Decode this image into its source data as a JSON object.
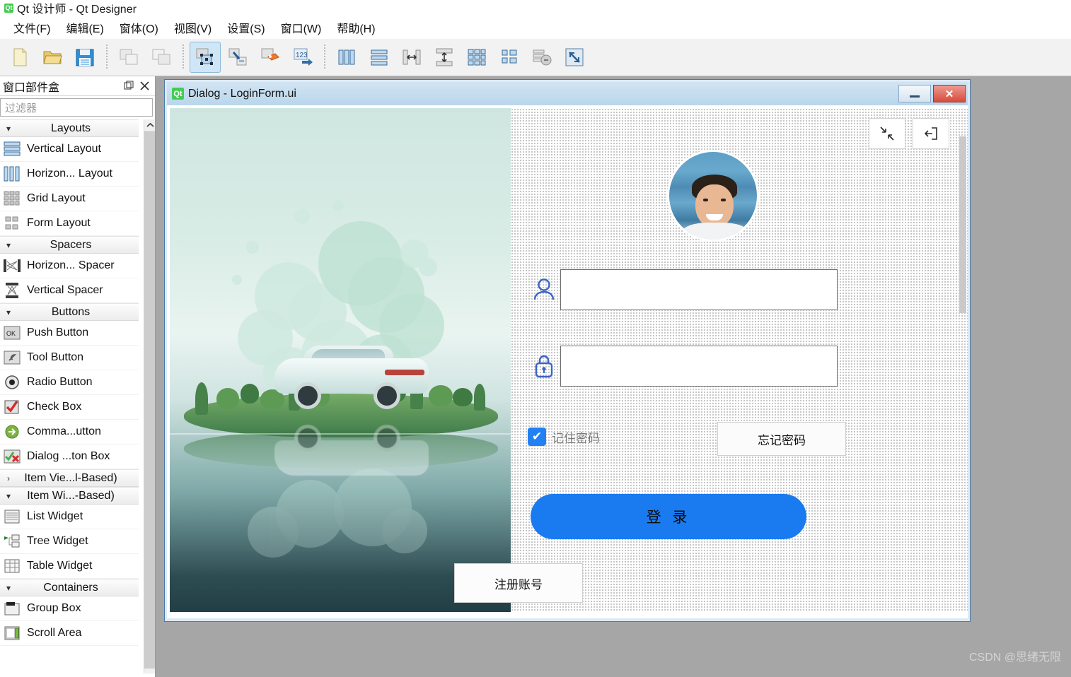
{
  "window": {
    "title": "Qt 设计师 - Qt Designer",
    "logo_text": "Qt"
  },
  "menubar": {
    "items": [
      {
        "label": "文件(F)",
        "name": "menu-file"
      },
      {
        "label": "编辑(E)",
        "name": "menu-edit"
      },
      {
        "label": "窗体(O)",
        "name": "menu-form"
      },
      {
        "label": "视图(V)",
        "name": "menu-view"
      },
      {
        "label": "设置(S)",
        "name": "menu-settings"
      },
      {
        "label": "窗口(W)",
        "name": "menu-window"
      },
      {
        "label": "帮助(H)",
        "name": "menu-help"
      }
    ]
  },
  "toolbar": {
    "groups": [
      [
        "new-file-icon",
        "open-file-icon",
        "save-file-icon"
      ],
      [
        "cascade-windows-icon",
        "tile-windows-icon"
      ],
      [
        "edit-widgets-icon",
        "edit-signals-slots-icon",
        "edit-buddies-icon",
        "edit-tab-order-icon"
      ],
      [
        "layout-horizontally-icon",
        "layout-vertically-icon",
        "layout-splitter-horizontal-icon",
        "layout-splitter-vertical-icon",
        "layout-grid-icon",
        "layout-form-icon",
        "break-layout-icon",
        "adjust-size-icon"
      ]
    ]
  },
  "widgetbox": {
    "title": "窗口部件盒",
    "float_icon": "float-panel-icon",
    "close_icon": "close-icon",
    "filter_placeholder": "过滤器",
    "sections": [
      {
        "name": "Layouts",
        "label": "Layouts",
        "expanded": true,
        "arrow": "▾",
        "items": [
          {
            "label": "Vertical Layout",
            "icon": "vertical-layout-icon"
          },
          {
            "label": "Horizon... Layout",
            "icon": "horizontal-layout-icon"
          },
          {
            "label": "Grid Layout",
            "icon": "grid-layout-icon"
          },
          {
            "label": "Form Layout",
            "icon": "form-layout-icon"
          }
        ]
      },
      {
        "name": "Spacers",
        "label": "Spacers",
        "expanded": true,
        "arrow": "▾",
        "items": [
          {
            "label": "Horizon... Spacer",
            "icon": "horizontal-spacer-icon"
          },
          {
            "label": "Vertical Spacer",
            "icon": "vertical-spacer-icon"
          }
        ]
      },
      {
        "name": "Buttons",
        "label": "Buttons",
        "expanded": true,
        "arrow": "▾",
        "items": [
          {
            "label": "Push Button",
            "icon": "push-button-icon"
          },
          {
            "label": "Tool Button",
            "icon": "tool-button-icon"
          },
          {
            "label": "Radio Button",
            "icon": "radio-button-icon"
          },
          {
            "label": "Check Box",
            "icon": "check-box-icon"
          },
          {
            "label": "Comma...utton",
            "icon": "command-link-button-icon"
          },
          {
            "label": "Dialog ...ton Box",
            "icon": "dialog-button-box-icon"
          }
        ]
      },
      {
        "name": "ItemViews",
        "label": "Item Vie...l-Based)",
        "expanded": false,
        "arrow": "›",
        "items": []
      },
      {
        "name": "ItemWidgets",
        "label": "Item Wi...-Based)",
        "expanded": true,
        "arrow": "▾",
        "items": [
          {
            "label": "List Widget",
            "icon": "list-widget-icon"
          },
          {
            "label": "Tree Widget",
            "icon": "tree-widget-icon"
          },
          {
            "label": "Table Widget",
            "icon": "table-widget-icon"
          }
        ]
      },
      {
        "name": "Containers",
        "label": "Containers",
        "expanded": true,
        "arrow": "▾",
        "items": [
          {
            "label": "Group Box",
            "icon": "group-box-icon"
          },
          {
            "label": "Scroll Area",
            "icon": "scroll-area-icon"
          }
        ]
      }
    ]
  },
  "dialog": {
    "logo_text": "Qt",
    "title": "Dialog - LoginForm.ui",
    "minimize_label": "",
    "close_label": "✕"
  },
  "form": {
    "collapse_icon": "collapse-arrows-icon",
    "exit_icon": "exit-icon",
    "avatar_name": "user-avatar",
    "username": {
      "icon": "person-icon",
      "value": "",
      "placeholder": ""
    },
    "password": {
      "icon": "lock-icon",
      "value": "",
      "placeholder": ""
    },
    "remember": {
      "label": "记住密码",
      "checked": true,
      "check_glyph": "✔"
    },
    "forgot_label": "忘记密码",
    "login_label": "登 录",
    "register_label": "注册账号"
  },
  "colors": {
    "accent_blue": "#1a7bf0",
    "checkbox_blue": "#2181f3",
    "field_icon_blue": "#3d63c4",
    "qt_green": "#41cd52",
    "workspace_gray": "#a6a6a6"
  },
  "watermark": "CSDN @思绪无限"
}
